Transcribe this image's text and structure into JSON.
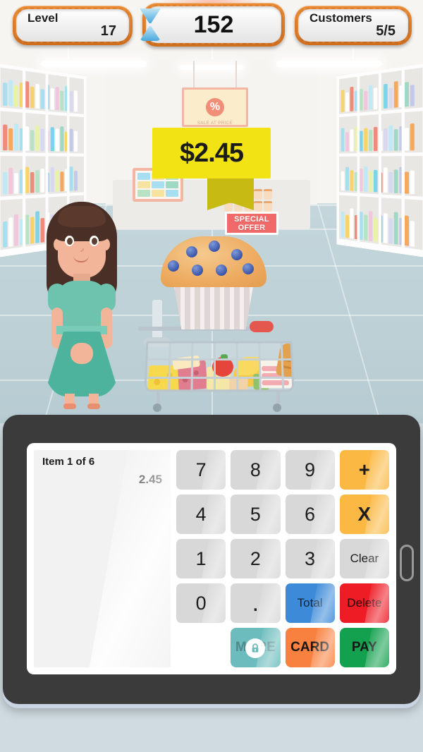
{
  "hud": {
    "level": {
      "label": "Level",
      "value": "17"
    },
    "timer": {
      "value": "152",
      "icon": "hourglass-icon"
    },
    "customers": {
      "label": "Customers",
      "value": "5/5"
    }
  },
  "scene": {
    "price_tag": "$2.45",
    "special_offer": {
      "line1": "SPECIAL",
      "line2": "OFFER"
    },
    "hanging_banner": {
      "symbol": "%",
      "subtitle": "SALE AT PRICE"
    },
    "product": "blueberry-muffin",
    "customer": "female-shopper",
    "cart": "shopping-cart-full"
  },
  "register": {
    "display": {
      "item_label": "Item 1 of 6",
      "amount": "2.45"
    },
    "keys": [
      {
        "label": "7",
        "name": "key-7",
        "style": "num"
      },
      {
        "label": "8",
        "name": "key-8",
        "style": "num"
      },
      {
        "label": "9",
        "name": "key-9",
        "style": "num"
      },
      {
        "label": "+",
        "name": "key-plus",
        "style": "op"
      },
      {
        "label": "4",
        "name": "key-4",
        "style": "num"
      },
      {
        "label": "5",
        "name": "key-5",
        "style": "num"
      },
      {
        "label": "6",
        "name": "key-6",
        "style": "num"
      },
      {
        "label": "X",
        "name": "key-multiply",
        "style": "op"
      },
      {
        "label": "1",
        "name": "key-1",
        "style": "num"
      },
      {
        "label": "2",
        "name": "key-2",
        "style": "num"
      },
      {
        "label": "3",
        "name": "key-3",
        "style": "num"
      },
      {
        "label": "Clear",
        "name": "key-clear",
        "style": "word"
      },
      {
        "label": "0",
        "name": "key-0",
        "style": "num"
      },
      {
        "label": ".",
        "name": "key-decimal",
        "style": "dot"
      },
      {
        "label": "Total",
        "name": "key-total",
        "style": "blue"
      },
      {
        "label": "Delete",
        "name": "key-delete",
        "style": "red"
      }
    ],
    "actions": [
      {
        "label": "MORE",
        "name": "more-button",
        "style": "teal",
        "locked": true
      },
      {
        "label": "CARD",
        "name": "card-button",
        "style": "orange",
        "locked": false
      },
      {
        "label": "PAY",
        "name": "pay-button",
        "style": "green",
        "locked": false
      }
    ],
    "side_button": "power-button"
  },
  "colors": {
    "plaque_wood": "#cf6d1c",
    "price_tag": "#f2e314",
    "operator": "#fbb944",
    "total": "#3d8bd8",
    "delete": "#ee1c25",
    "card": "#f9813f",
    "pay": "#13a14f",
    "more_locked": "#6cbcbd",
    "dress": "#4db39c"
  }
}
